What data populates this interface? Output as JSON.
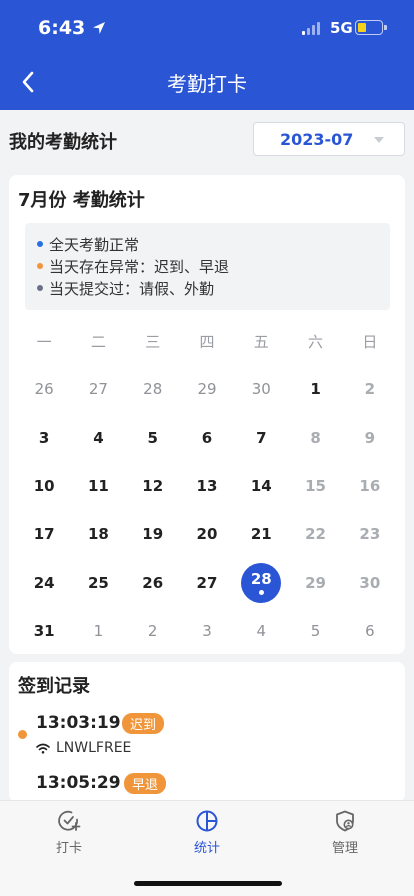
{
  "status_bar": {
    "time": "6:43",
    "network": "5G"
  },
  "nav": {
    "title": "考勤打卡"
  },
  "summary": {
    "title": "我的考勤统计",
    "month": "2023-07"
  },
  "calendar": {
    "title": "7月份 考勤统计",
    "legend": [
      {
        "text": "全天考勤正常",
        "color": "#2a6fe0"
      },
      {
        "text": "当天存在异常：迟到、早退",
        "color": "#f0953a"
      },
      {
        "text": "当天提交过：请假、外勤",
        "color": "#6b6f8a"
      }
    ],
    "weekdays": [
      "一",
      "二",
      "三",
      "四",
      "五",
      "六",
      "日"
    ],
    "days": [
      {
        "d": "26",
        "t": "other"
      },
      {
        "d": "27",
        "t": "other"
      },
      {
        "d": "28",
        "t": "other"
      },
      {
        "d": "29",
        "t": "other"
      },
      {
        "d": "30",
        "t": "other"
      },
      {
        "d": "1",
        "t": "cur"
      },
      {
        "d": "2",
        "t": "weekend"
      },
      {
        "d": "3",
        "t": "cur"
      },
      {
        "d": "4",
        "t": "cur"
      },
      {
        "d": "5",
        "t": "cur"
      },
      {
        "d": "6",
        "t": "cur"
      },
      {
        "d": "7",
        "t": "cur"
      },
      {
        "d": "8",
        "t": "weekend"
      },
      {
        "d": "9",
        "t": "weekend"
      },
      {
        "d": "10",
        "t": "cur"
      },
      {
        "d": "11",
        "t": "cur"
      },
      {
        "d": "12",
        "t": "cur"
      },
      {
        "d": "13",
        "t": "cur"
      },
      {
        "d": "14",
        "t": "cur"
      },
      {
        "d": "15",
        "t": "weekend"
      },
      {
        "d": "16",
        "t": "weekend"
      },
      {
        "d": "17",
        "t": "cur"
      },
      {
        "d": "18",
        "t": "cur"
      },
      {
        "d": "19",
        "t": "cur"
      },
      {
        "d": "20",
        "t": "cur"
      },
      {
        "d": "21",
        "t": "cur"
      },
      {
        "d": "22",
        "t": "weekend"
      },
      {
        "d": "23",
        "t": "weekend"
      },
      {
        "d": "24",
        "t": "cur"
      },
      {
        "d": "25",
        "t": "cur"
      },
      {
        "d": "26",
        "t": "cur"
      },
      {
        "d": "27",
        "t": "cur"
      },
      {
        "d": "28",
        "t": "selected"
      },
      {
        "d": "29",
        "t": "weekend"
      },
      {
        "d": "30",
        "t": "weekend"
      },
      {
        "d": "31",
        "t": "cur"
      },
      {
        "d": "1",
        "t": "other"
      },
      {
        "d": "2",
        "t": "other"
      },
      {
        "d": "3",
        "t": "other"
      },
      {
        "d": "4",
        "t": "other"
      },
      {
        "d": "5",
        "t": "other"
      },
      {
        "d": "6",
        "t": "other"
      }
    ]
  },
  "records": {
    "title": "签到记录",
    "items": [
      {
        "time": "13:03:19",
        "badge": "迟到",
        "wifi": "LNWLFREE"
      },
      {
        "time": "13:05:29",
        "badge": "早退",
        "wifi": ""
      }
    ]
  },
  "tabbar": {
    "items": [
      {
        "label": "打卡",
        "icon": "check-circle-plus-icon"
      },
      {
        "label": "统计",
        "icon": "pie-chart-icon"
      },
      {
        "label": "管理",
        "icon": "shield-user-icon"
      }
    ]
  }
}
